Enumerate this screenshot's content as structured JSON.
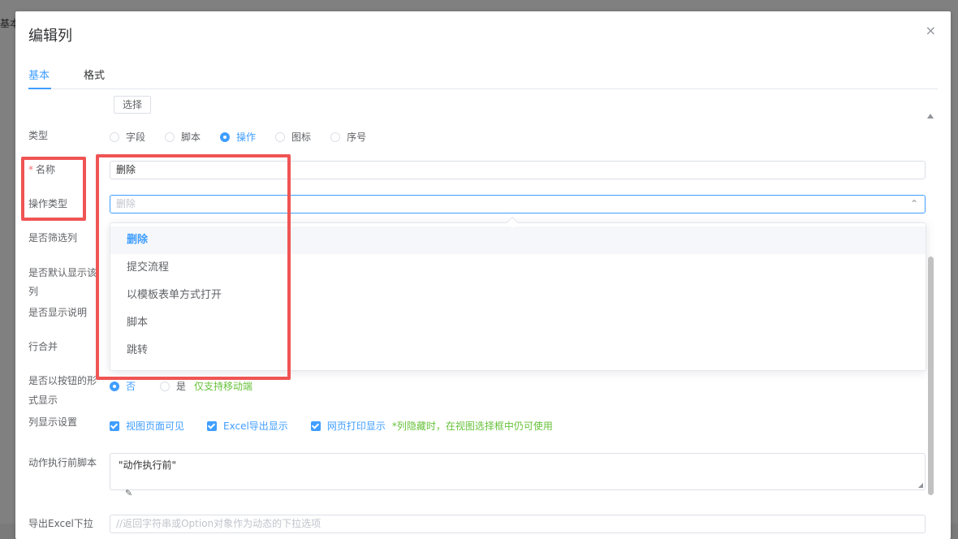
{
  "background": {
    "fragment": "基本"
  },
  "dialog": {
    "title": "编辑列",
    "close_glyph": "×"
  },
  "tabs": [
    {
      "label": "基本",
      "active": true
    },
    {
      "label": "格式",
      "active": false
    }
  ],
  "form": {
    "select_button": "选择",
    "type": {
      "label": "类型",
      "options": [
        "字段",
        "脚本",
        "操作",
        "图标",
        "序号"
      ],
      "selected": "操作"
    },
    "name": {
      "required_mark": "*",
      "label": "名称",
      "value": "删除"
    },
    "action_type": {
      "label": "操作类型",
      "placeholder": "删除",
      "options": [
        "删除",
        "提交流程",
        "以模板表单方式打开",
        "脚本",
        "跳转"
      ],
      "selected": "删除"
    },
    "filter_col_label": "是否筛选列",
    "default_show_label_1": "是否默认显示该",
    "default_show_label_2": "列",
    "show_desc_label": "是否显示说明",
    "row_merge_label": "行合并",
    "as_button": {
      "label_1": "是否以按钮的形",
      "label_2": "式显示",
      "option_no": "否",
      "option_yes": "是",
      "hint": "仅支持移动端"
    },
    "col_display": {
      "label": "列显示设置",
      "checks": [
        "视图页面可见",
        "Excel导出显示",
        "网页打印显示"
      ],
      "hint": "*列隐藏时，在视图选择框中仍可使用"
    },
    "pre_script": {
      "label": "动作执行前脚本",
      "value": "\"动作执行前\""
    },
    "excel_label": "导出Excel下拉",
    "excel_placeholder": "//返回字符串或Option对象作为动态的下拉选项"
  },
  "icons": {
    "chevron_up": "⌃",
    "edit": "✎",
    "resize": "◢"
  },
  "colors": {
    "accent": "#409eff",
    "highlight": "#f05454",
    "hint_green": "#67c23a"
  }
}
